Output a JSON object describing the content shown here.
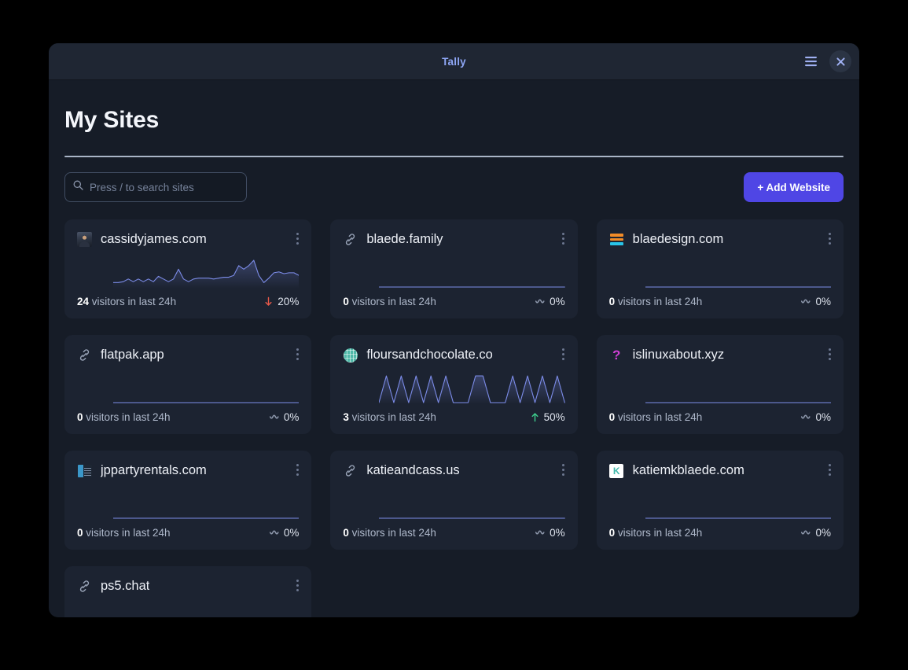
{
  "window": {
    "title": "Tally",
    "menu_icon": "hamburger-menu-icon",
    "close_icon": "close-icon"
  },
  "page": {
    "title": "My Sites"
  },
  "toolbar": {
    "search_placeholder": "Press / to search sites",
    "search_value": "",
    "search_icon": "search-icon",
    "add_website_label": "+ Add Website"
  },
  "colors": {
    "accent": "#4f46e5",
    "window_bg": "#161c27",
    "card_bg": "#1c2331",
    "headerbar_bg": "#1f2633",
    "title_accent": "#8ea6f5",
    "spark_line": "#7c8ce8",
    "trend_up": "#3ecf8e",
    "trend_down": "#e8594a",
    "trend_flat": "#8d97ab"
  },
  "sites": [
    {
      "name": "cassidyjames.com",
      "favicon": "photo-avatar-favicon",
      "visitors": "24",
      "visitors_text": "visitors in last 24h",
      "trend_direction": "down",
      "trend_value": "20%",
      "trend_icon": "arrow-down-icon",
      "sparkline": [
        5,
        5,
        6,
        9,
        6,
        9,
        6,
        9,
        6,
        12,
        9,
        6,
        9,
        20,
        9,
        6,
        9,
        10,
        10,
        10,
        9,
        10,
        11,
        11,
        13,
        24,
        20,
        24,
        30,
        13,
        5,
        10,
        16,
        17,
        15,
        16,
        16,
        13
      ]
    },
    {
      "name": "blaede.family",
      "favicon": "link-icon",
      "visitors": "0",
      "visitors_text": "visitors in last 24h",
      "trend_direction": "flat",
      "trend_value": "0%",
      "trend_icon": "wave-flat-icon",
      "sparkline": [
        0,
        0,
        0,
        0,
        0,
        0,
        0,
        0,
        0,
        0,
        0,
        0,
        0,
        0,
        0,
        0,
        0,
        0,
        0,
        0,
        0,
        0,
        0,
        0
      ]
    },
    {
      "name": "blaedesign.com",
      "favicon": "orange-cyan-bars-favicon",
      "visitors": "0",
      "visitors_text": "visitors in last 24h",
      "trend_direction": "flat",
      "trend_value": "0%",
      "trend_icon": "wave-flat-icon",
      "sparkline": [
        0,
        0,
        0,
        0,
        0,
        0,
        0,
        0,
        0,
        0,
        0,
        0,
        0,
        0,
        0,
        0,
        0,
        0,
        0,
        0,
        0,
        0,
        0,
        0
      ]
    },
    {
      "name": "flatpak.app",
      "favicon": "link-icon",
      "visitors": "0",
      "visitors_text": "visitors in last 24h",
      "trend_direction": "flat",
      "trend_value": "0%",
      "trend_icon": "wave-flat-icon",
      "sparkline": [
        0,
        0,
        0,
        0,
        0,
        0,
        0,
        0,
        0,
        0,
        0,
        0,
        0,
        0,
        0,
        0,
        0,
        0,
        0,
        0,
        0,
        0,
        0,
        0
      ]
    },
    {
      "name": "floursandchocolate.co",
      "favicon": "globe-favicon",
      "visitors": "3",
      "visitors_text": "visitors in last 24h",
      "trend_direction": "up",
      "trend_value": "50%",
      "trend_icon": "arrow-up-icon",
      "sparkline": [
        0,
        30,
        0,
        30,
        0,
        30,
        0,
        30,
        0,
        30,
        0,
        0,
        0,
        30,
        30,
        0,
        0,
        0,
        30,
        0,
        30,
        0,
        30,
        0,
        30,
        0
      ]
    },
    {
      "name": "islinuxabout.xyz",
      "favicon": "question-mark-favicon",
      "visitors": "0",
      "visitors_text": "visitors in last 24h",
      "trend_direction": "flat",
      "trend_value": "0%",
      "trend_icon": "wave-flat-icon",
      "sparkline": [
        0,
        0,
        0,
        0,
        0,
        0,
        0,
        0,
        0,
        0,
        0,
        0,
        0,
        0,
        0,
        0,
        0,
        0,
        0,
        0,
        0,
        0,
        0,
        0
      ]
    },
    {
      "name": "jppartyrentals.com",
      "favicon": "jp-thumbnail-favicon",
      "visitors": "0",
      "visitors_text": "visitors in last 24h",
      "trend_direction": "flat",
      "trend_value": "0%",
      "trend_icon": "wave-flat-icon",
      "sparkline": [
        0,
        0,
        0,
        0,
        0,
        0,
        0,
        0,
        0,
        0,
        0,
        0,
        0,
        0,
        0,
        0,
        0,
        0,
        0,
        0,
        0,
        0,
        0,
        0
      ]
    },
    {
      "name": "katieandcass.us",
      "favicon": "link-icon",
      "visitors": "0",
      "visitors_text": "visitors in last 24h",
      "trend_direction": "flat",
      "trend_value": "0%",
      "trend_icon": "wave-flat-icon",
      "sparkline": [
        0,
        0,
        0,
        0,
        0,
        0,
        0,
        0,
        0,
        0,
        0,
        0,
        0,
        0,
        0,
        0,
        0,
        0,
        0,
        0,
        0,
        0,
        0,
        0
      ]
    },
    {
      "name": "katiemkblaede.com",
      "favicon": "letter-k-favicon",
      "visitors": "0",
      "visitors_text": "visitors in last 24h",
      "trend_direction": "flat",
      "trend_value": "0%",
      "trend_icon": "wave-flat-icon",
      "sparkline": [
        0,
        0,
        0,
        0,
        0,
        0,
        0,
        0,
        0,
        0,
        0,
        0,
        0,
        0,
        0,
        0,
        0,
        0,
        0,
        0,
        0,
        0,
        0,
        0
      ]
    },
    {
      "name": "ps5.chat",
      "favicon": "link-icon",
      "visitors": "",
      "visitors_text": "",
      "trend_direction": "flat",
      "trend_value": "",
      "trend_icon": "",
      "sparkline": []
    }
  ]
}
